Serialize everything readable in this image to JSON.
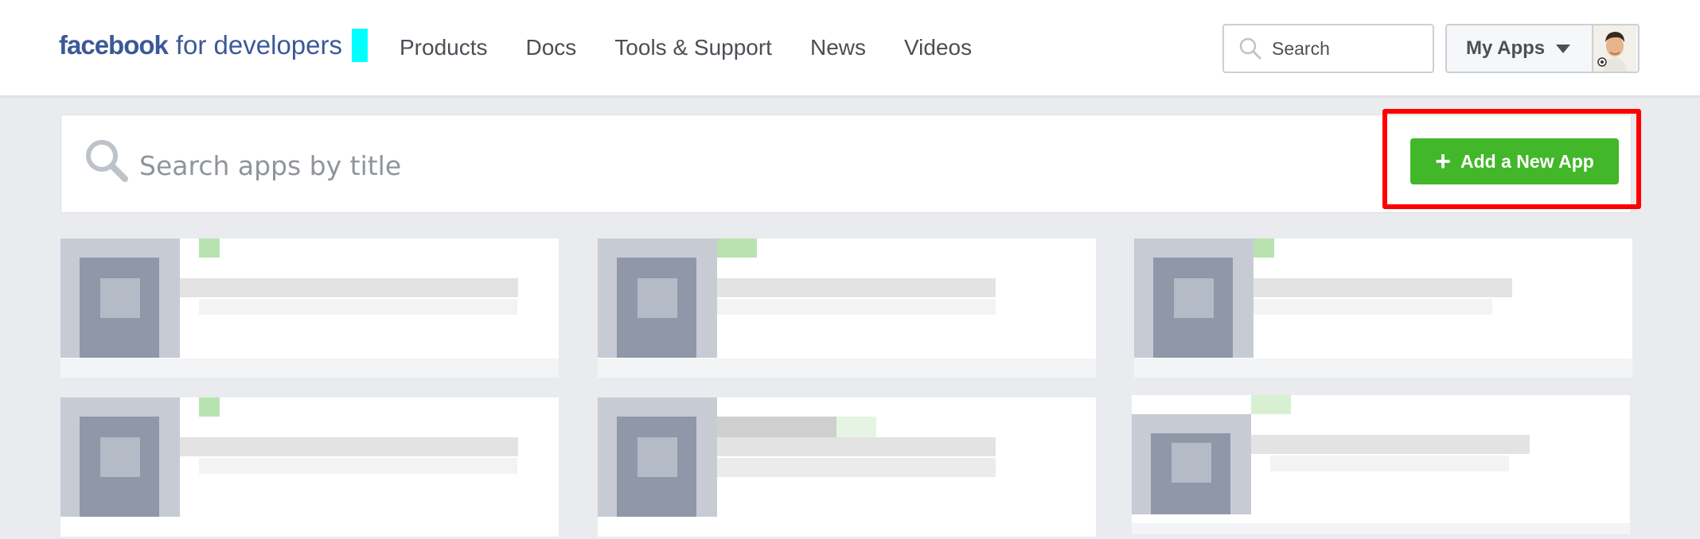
{
  "brand": {
    "facebook": "facebook",
    "for_developers": "for developers",
    "accent_color": "#00ffff",
    "brand_color": "#3b5998"
  },
  "nav": {
    "items": [
      "Products",
      "Docs",
      "Tools & Support",
      "News",
      "Videos"
    ]
  },
  "header_search": {
    "placeholder": "Search",
    "icon": "search-icon"
  },
  "my_apps": {
    "label": "My Apps",
    "icon": "chevron-down-icon"
  },
  "apps_search": {
    "placeholder": "Search apps by title",
    "icon": "search-icon"
  },
  "add_app_button": {
    "label": "Add a New App",
    "icon": "plus-icon",
    "color": "#42b72a"
  },
  "highlight_color": "#ff0000",
  "apps_grid": {
    "cards": 6,
    "columns": 3,
    "content": "blurred/pixelated app tiles"
  }
}
